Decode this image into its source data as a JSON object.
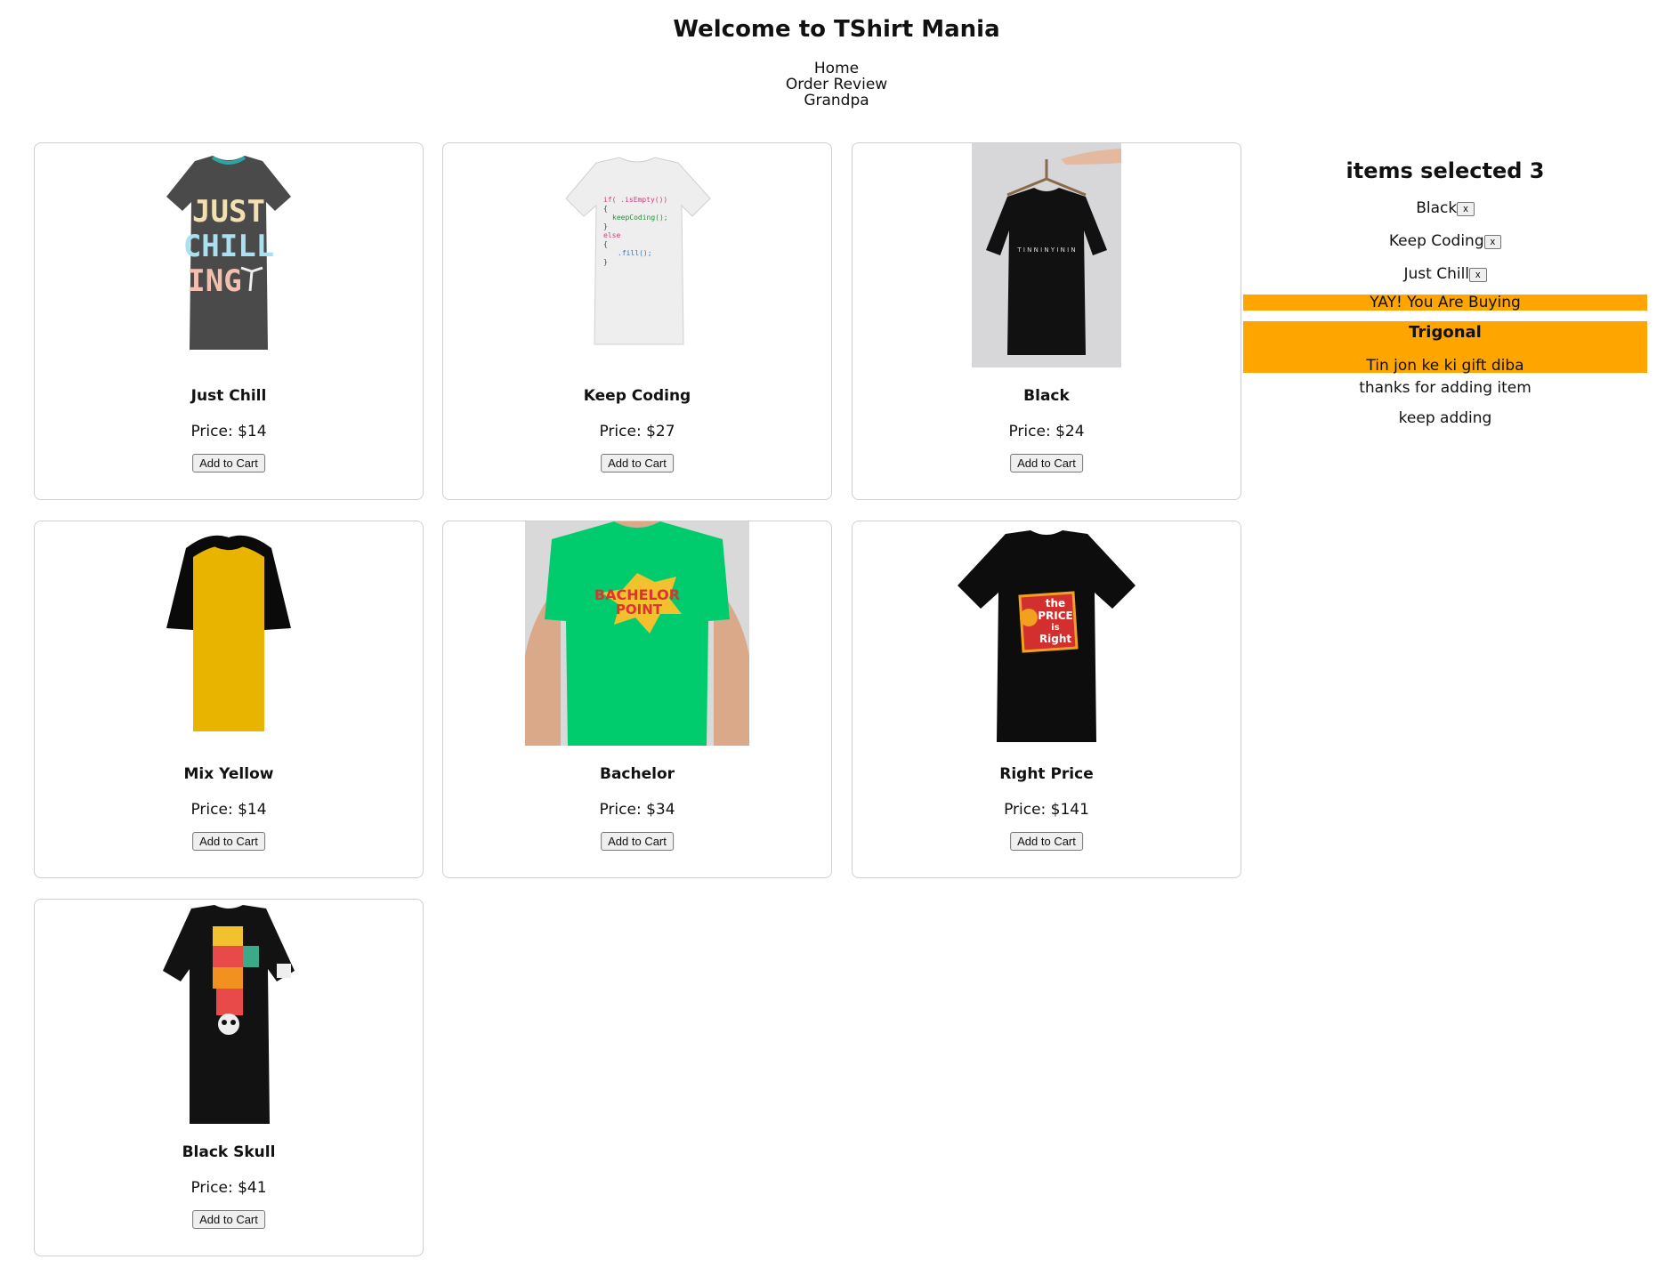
{
  "header": {
    "title": "Welcome to TShirt Mania",
    "nav": [
      "Home",
      "Order Review",
      "Grandpa"
    ]
  },
  "products": [
    {
      "name": "Just Chill",
      "price": "Price: $14",
      "button": "Add to Cart",
      "image_icon": "gray-tshirt-just-chilling"
    },
    {
      "name": "Keep Coding",
      "price": "Price: $27",
      "button": "Add to Cart",
      "image_icon": "white-tshirt-code"
    },
    {
      "name": "Black",
      "price": "Price: $24",
      "button": "Add to Cart",
      "image_icon": "black-tshirt-on-hanger"
    },
    {
      "name": "Mix Yellow",
      "price": "Price: $14",
      "button": "Add to Cart",
      "image_icon": "yellow-raglan-tshirt"
    },
    {
      "name": "Bachelor",
      "price": "Price: $34",
      "button": "Add to Cart",
      "image_icon": "green-tshirt-bachelor-point"
    },
    {
      "name": "Right Price",
      "price": "Price: $141",
      "button": "Add to Cart",
      "image_icon": "black-tshirt-price-is-right"
    },
    {
      "name": "Black Skull",
      "price": "Price: $41",
      "button": "Add to Cart",
      "image_icon": "black-tshirt-skull-graphic"
    }
  ],
  "cart": {
    "heading": "items selected 3",
    "items": [
      {
        "name": "Black",
        "remove": "x"
      },
      {
        "name": "Keep Coding",
        "remove": "x"
      },
      {
        "name": "Just Chill",
        "remove": "x"
      }
    ],
    "banner": "YAY! You Are Buying",
    "gift_title": "Trigonal",
    "gift_text": "Tin jon ke ki gift diba",
    "messages": [
      "thanks for adding item",
      "keep adding"
    ]
  },
  "image_texts": {
    "just_chilling": [
      "JUST",
      "CHILL",
      "ING"
    ],
    "code": [
      "if( .isEmpty())",
      "{",
      "keepCoding();",
      "}",
      "else",
      "{",
      ".fill();",
      "}"
    ],
    "bachelor": [
      "BACHELOR",
      "POINT"
    ],
    "price_right": [
      "the",
      "PRICE",
      "is",
      "Right"
    ]
  },
  "colors": {
    "accent": "#ffa500",
    "card_border": "#cfcfcf"
  }
}
